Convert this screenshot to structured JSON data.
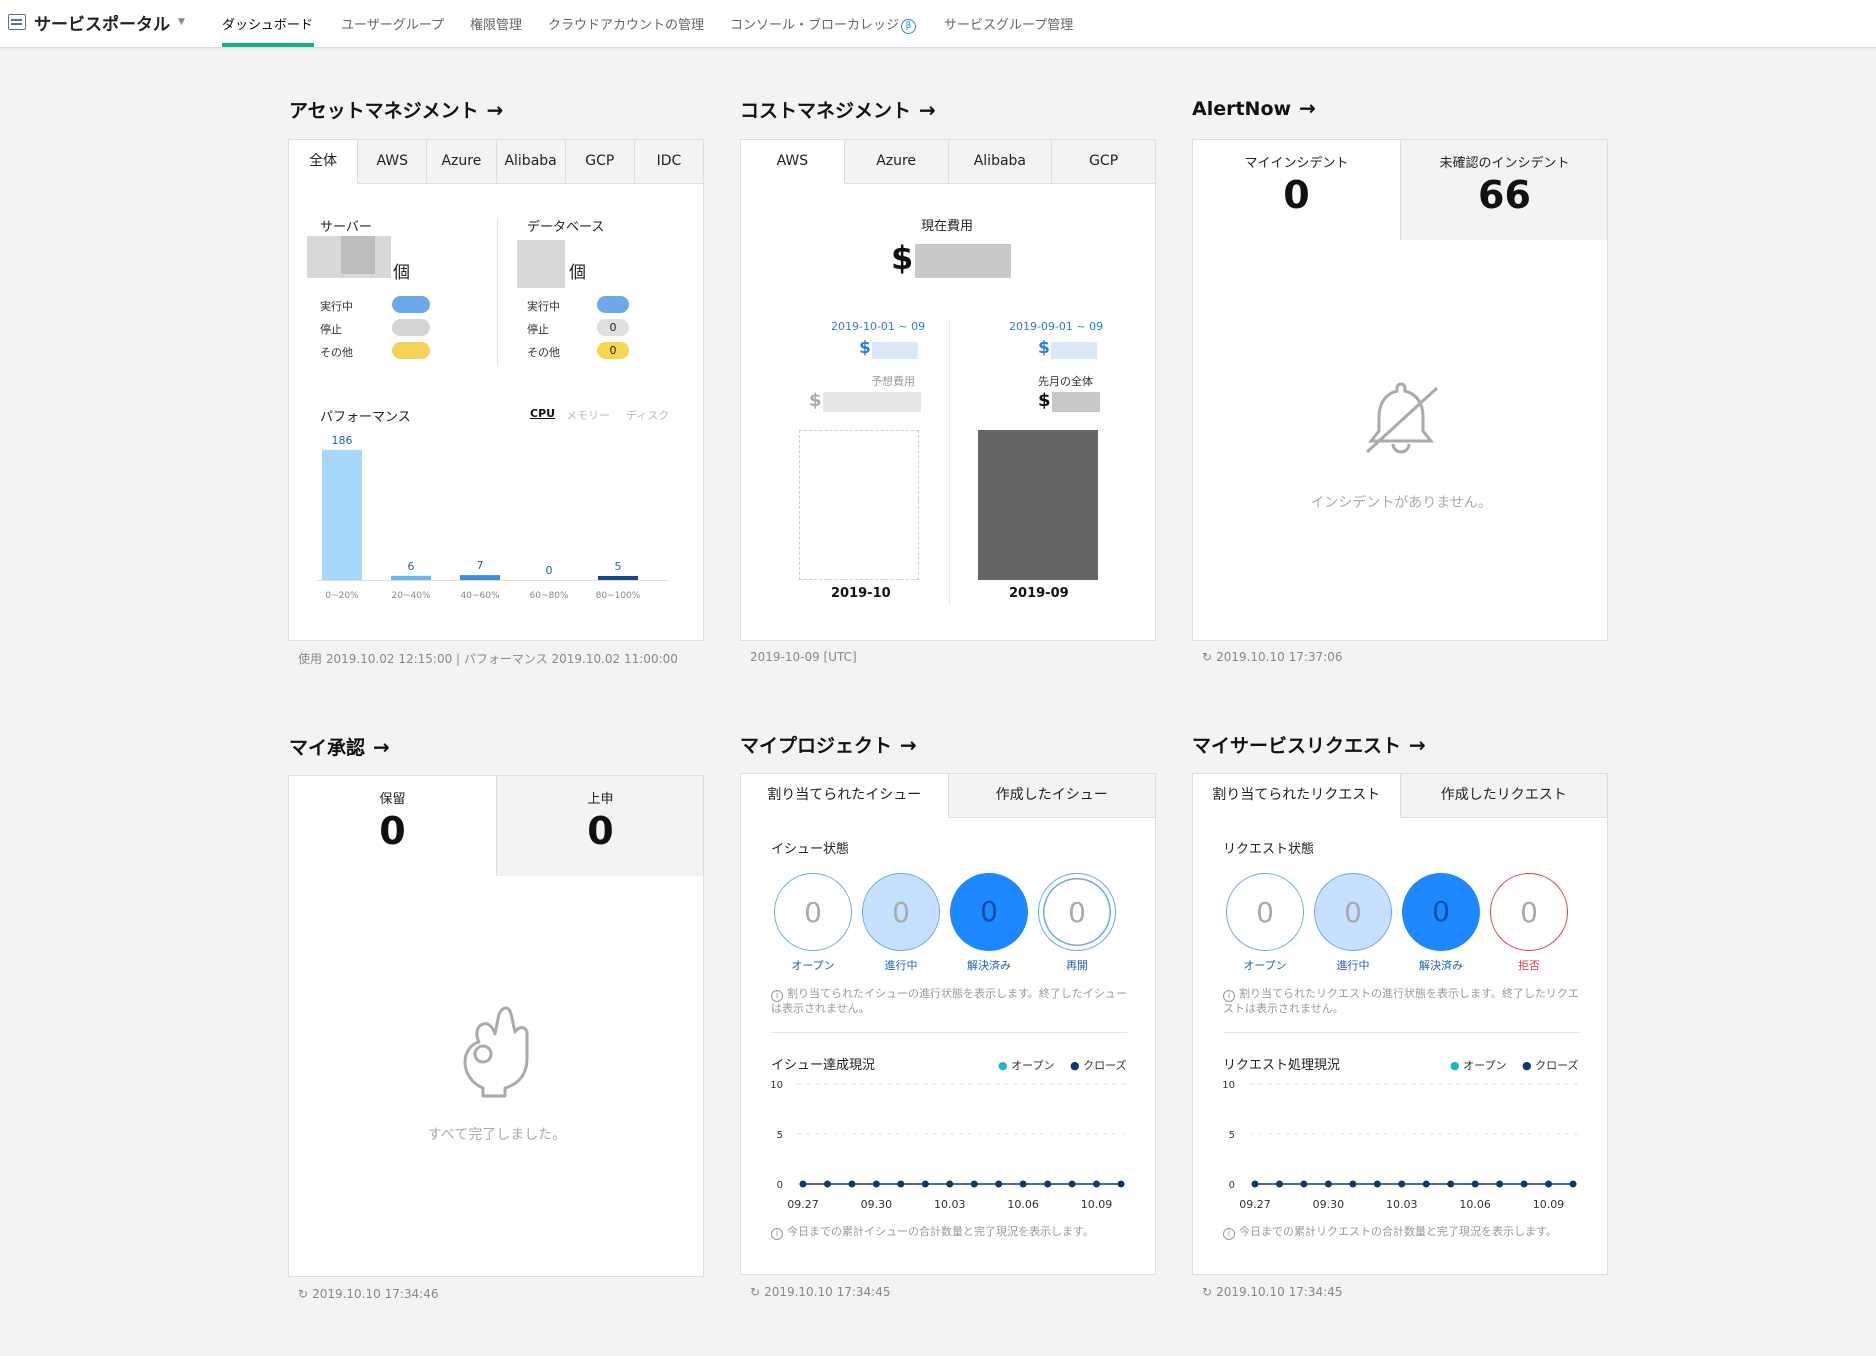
{
  "header": {
    "portal_title": "サービスポータル",
    "tabs": [
      {
        "label": "ダッシュボード"
      },
      {
        "label": "ユーザーグループ"
      },
      {
        "label": "権限管理"
      },
      {
        "label": "クラウドアカウントの管理"
      },
      {
        "label": "コンソール・ブローカレッジ"
      },
      {
        "label": "サービスグループ管理"
      }
    ],
    "beta_badge": "β"
  },
  "asset": {
    "title": "アセットマネジメント",
    "tabs": [
      "全体",
      "AWS",
      "Azure",
      "Alibaba",
      "GCP",
      "IDC"
    ],
    "server_label": "サーバー",
    "db_label": "データベース",
    "unit": "個",
    "status_running": "実行中",
    "status_stopped": "停止",
    "status_other": "その他",
    "db_stopped_value": "0",
    "db_other_value": "0",
    "perf_label": "パフォーマンス",
    "perf_tabs": [
      "CPU",
      "メモリー",
      "ディスク"
    ],
    "footer": "使用 2019.10.02 12:15:00 | パフォーマンス 2019.10.02 11:00:00"
  },
  "chart_data": {
    "type": "bar",
    "categories": [
      "0~20%",
      "20~40%",
      "40~60%",
      "60~80%",
      "80~100%"
    ],
    "values": [
      186,
      6,
      7,
      0,
      5
    ],
    "colors": [
      "#a7d8fb",
      "#6cb8f0",
      "#3b8fd8",
      "#1f66b5",
      "#134a8a"
    ]
  },
  "cost": {
    "title": "コストマネジメント",
    "tabs": [
      "AWS",
      "Azure",
      "Alibaba",
      "GCP"
    ],
    "current_label": "現在費用",
    "currency": "$",
    "left_period": "2019-10-01 ~ 09",
    "right_period": "2019-09-01 ~ 09",
    "forecast_label": "予想費用",
    "last_month_label": "先月の全体",
    "left_month": "2019-10",
    "right_month": "2019-09",
    "footer": "2019-10-09 [UTC]"
  },
  "alert": {
    "title": "AlertNow",
    "my_incident_label": "マイインシデント",
    "my_incident_value": "0",
    "unconfirmed_label": "未確認のインシデント",
    "unconfirmed_value": "66",
    "empty_text": "インシデントがありません。",
    "footer": "2019.10.10 17:37:06"
  },
  "approval": {
    "title": "マイ承認",
    "pending_label": "保留",
    "pending_value": "0",
    "submitted_label": "上申",
    "submitted_value": "0",
    "empty_text": "すべて完了しました。",
    "footer": "2019.10.10 17:34:46"
  },
  "project": {
    "title": "マイプロジェクト",
    "tabs": [
      "割り当てられたイシュー",
      "作成したイシュー"
    ],
    "status_title": "イシュー状態",
    "circles": [
      {
        "label": "オープン",
        "value": "0"
      },
      {
        "label": "進行中",
        "value": "0"
      },
      {
        "label": "解決済み",
        "value": "0"
      },
      {
        "label": "再開",
        "value": "0"
      }
    ],
    "note": "割り当てられたイシューの進行状態を表示します。終了したイシューは表示されません。",
    "progress_title": "イシュー達成現況",
    "legend_open": "オープン",
    "legend_close": "クローズ",
    "y_ticks": [
      "10",
      "5",
      "0"
    ],
    "x_ticks": [
      "09.27",
      "09.30",
      "10.03",
      "10.06",
      "10.09"
    ],
    "bottom_note": "今日までの累計イシューの合計数量と完了現況を表示します。",
    "footer": "2019.10.10 17:34:45"
  },
  "request": {
    "title": "マイサービスリクエスト",
    "tabs": [
      "割り当てられたリクエスト",
      "作成したリクエスト"
    ],
    "status_title": "リクエスト状態",
    "circles": [
      {
        "label": "オープン",
        "value": "0"
      },
      {
        "label": "進行中",
        "value": "0"
      },
      {
        "label": "解決済み",
        "value": "0"
      },
      {
        "label": "拒否",
        "value": "0"
      }
    ],
    "note": "割り当てられたリクエストの進行状態を表示します。終了したリクエストは表示されません。",
    "progress_title": "リクエスト処理現況",
    "legend_open": "オープン",
    "legend_close": "クローズ",
    "y_ticks": [
      "10",
      "5",
      "0"
    ],
    "x_ticks": [
      "09.27",
      "09.30",
      "10.03",
      "10.06",
      "10.09"
    ],
    "bottom_note": "今日までの累計リクエストの合計数量と完了現況を表示します。",
    "footer": "2019.10.10 17:34:45"
  },
  "colors": {
    "accent": "#0fb38a",
    "blue": "#1e88ff",
    "light_blue": "#c6e0ff",
    "navy": "#0e3a6e",
    "teal": "#22b6c4",
    "red": "#e23b4c"
  }
}
